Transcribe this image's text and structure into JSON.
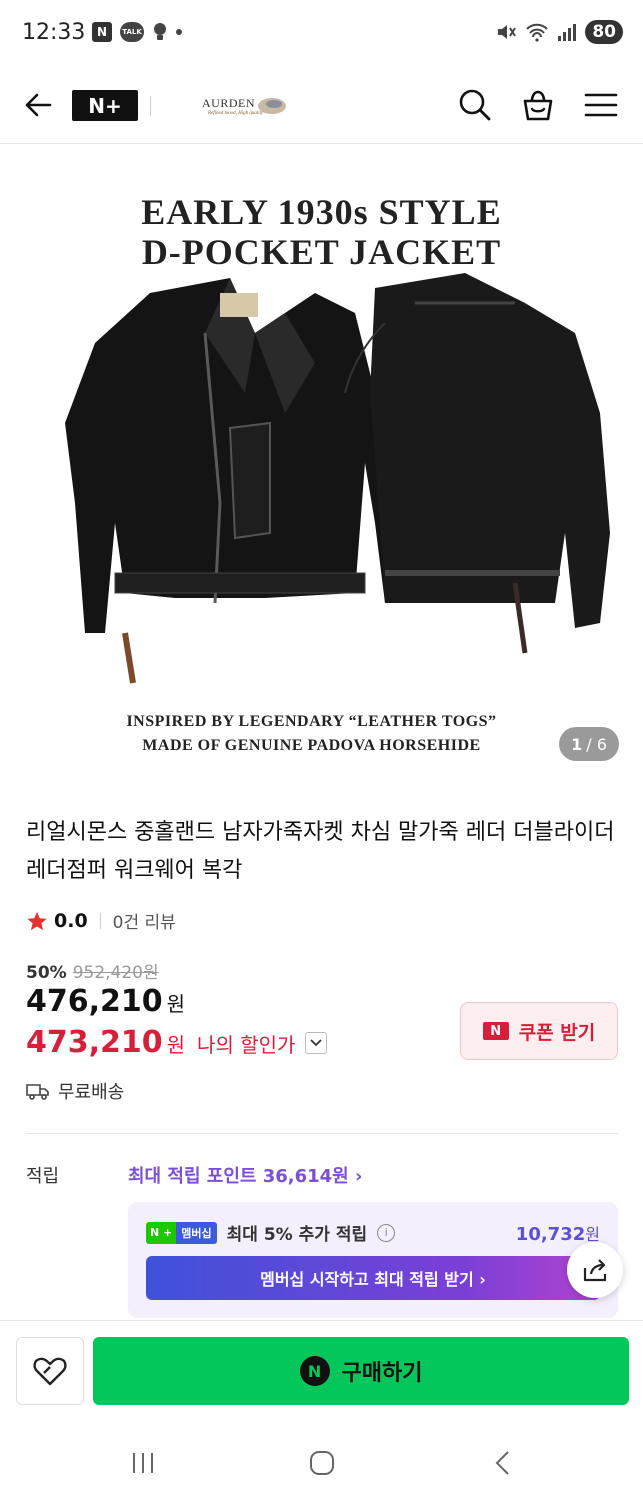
{
  "status_bar": {
    "time": "12:33",
    "n_badge": "N",
    "talk_badge": "TALK",
    "battery": "80"
  },
  "header": {
    "nplus": "N+",
    "brand_name": "AURDEN",
    "brand_tagline": "Refined mood, High quality"
  },
  "hero": {
    "title_line1": "EARLY 1930s STYLE",
    "title_line2": "D-POCKET JACKET",
    "caption_line1": "INSPIRED BY LEGENDARY “LEATHER TOGS”",
    "caption_line2": "MADE OF GENUINE PADOVA HORSEHIDE",
    "pager_current": "1",
    "pager_total": "/ 6"
  },
  "product": {
    "title": "리얼시몬스 중홀랜드 남자가죽자켓 차심 말가죽 레더 더블라이더 레더점퍼 워크웨어 복각",
    "rating": "0.0",
    "review_count": "0건 리뷰",
    "discount_pct": "50%",
    "original_price": "952,420원",
    "price": "476,210",
    "price_unit": "원",
    "my_price": "473,210",
    "my_price_unit": "원",
    "my_price_label": "나의 할인가",
    "coupon_badge": "N",
    "coupon_label": "쿠폰 받기",
    "shipping": "무료배송"
  },
  "points": {
    "label": "적립",
    "max_points": "최대 적립 포인트 36,614원 ›",
    "membership_tag_n": "N +",
    "membership_tag": "멤버십",
    "extra_label": "최대 5% 추가 적립",
    "info_icon_text": "i",
    "extra_amount": "10,732",
    "extra_unit": "원",
    "cta": "멤버십 시작하고 최대 적립 받기 ›"
  },
  "bottom": {
    "buy_badge": "N",
    "buy_label": "구매하기"
  },
  "colors": {
    "accent_green": "#03c75a",
    "price_red": "#d6203b",
    "points_purple": "#7a4fd6"
  }
}
